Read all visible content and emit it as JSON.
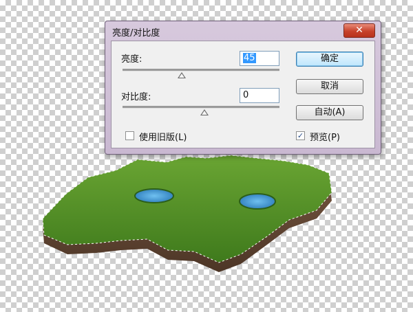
{
  "dialog": {
    "title": "亮度/对比度",
    "close_icon": "close-icon",
    "brightness": {
      "label": "亮度:",
      "value": "45",
      "slider_level": 0.5
    },
    "contrast": {
      "label": "对比度:",
      "value": "0",
      "slider_level": 0.5
    },
    "ok_label": "确定",
    "cancel_label": "取消",
    "auto_label": "自动(A)",
    "legacy": {
      "label": "使用旧版(L)",
      "checked": false
    },
    "preview": {
      "label": "预览(P)",
      "checked": true,
      "check_glyph": "✓"
    }
  },
  "canvas": {
    "background": "transparent-checkerboard",
    "island_color": "#4f8a22",
    "pond_color": "#3a8fd0"
  }
}
